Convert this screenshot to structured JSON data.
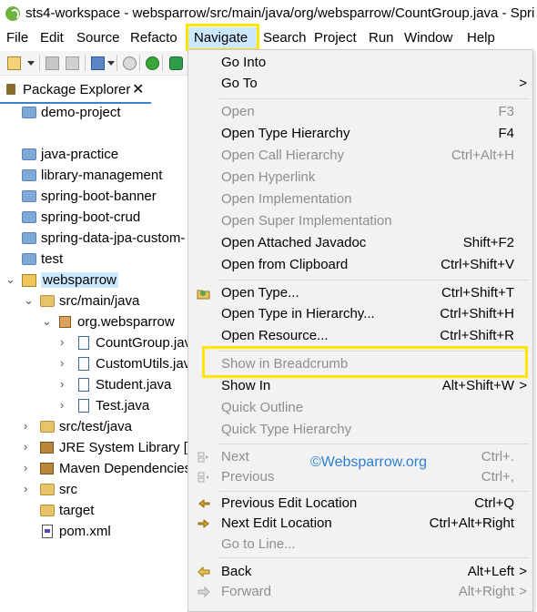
{
  "window": {
    "title": "sts4-workspace - websparrow/src/main/java/org/websparrow/CountGroup.java - Spri"
  },
  "menubar": {
    "items": [
      "File",
      "Edit",
      "Source",
      "Refacto",
      "Navigate",
      "Search",
      "Project",
      "Run",
      "Window",
      "Help"
    ],
    "active": "Navigate"
  },
  "explorer": {
    "tab_label": "Package Explorer",
    "close_glyph": "✕",
    "items": [
      {
        "label": "demo-project"
      },
      {
        "label": "java-practice"
      },
      {
        "label": "library-management"
      },
      {
        "label": "spring-boot-banner"
      },
      {
        "label": "spring-boot-crud"
      },
      {
        "label": "spring-data-jpa-custom-"
      },
      {
        "label": "test"
      },
      {
        "label": "websparrow"
      },
      {
        "label": "src/main/java"
      },
      {
        "label": "org.websparrow"
      },
      {
        "label": "CountGroup.java"
      },
      {
        "label": "CustomUtils.java"
      },
      {
        "label": "Student.java"
      },
      {
        "label": "Test.java"
      },
      {
        "label": "src/test/java"
      },
      {
        "label": "JRE System Library [Ja"
      },
      {
        "label": "Maven Dependencies"
      },
      {
        "label": "src"
      },
      {
        "label": "target"
      },
      {
        "label": "pom.xml"
      }
    ]
  },
  "navigate_menu": {
    "items": [
      {
        "label": "Go Into",
        "shortcut": "",
        "submenu": "",
        "enabled": true,
        "icon": ""
      },
      {
        "label": "Go To",
        "shortcut": "",
        "submenu": ">",
        "enabled": true,
        "icon": ""
      },
      {
        "label": "Open",
        "shortcut": "F3",
        "submenu": "",
        "enabled": false,
        "icon": ""
      },
      {
        "label": "Open Type Hierarchy",
        "shortcut": "F4",
        "submenu": "",
        "enabled": true,
        "icon": ""
      },
      {
        "label": "Open Call Hierarchy",
        "shortcut": "Ctrl+Alt+H",
        "submenu": "",
        "enabled": false,
        "icon": ""
      },
      {
        "label": "Open Hyperlink",
        "shortcut": "",
        "submenu": "",
        "enabled": false,
        "icon": ""
      },
      {
        "label": "Open Implementation",
        "shortcut": "",
        "submenu": "",
        "enabled": false,
        "icon": ""
      },
      {
        "label": "Open Super Implementation",
        "shortcut": "",
        "submenu": "",
        "enabled": false,
        "icon": ""
      },
      {
        "label": "Open Attached Javadoc",
        "shortcut": "Shift+F2",
        "submenu": "",
        "enabled": true,
        "icon": ""
      },
      {
        "label": "Open from Clipboard",
        "shortcut": "Ctrl+Shift+V",
        "submenu": "",
        "enabled": true,
        "icon": ""
      },
      {
        "label": "Open Type...",
        "shortcut": "Ctrl+Shift+T",
        "submenu": "",
        "enabled": true,
        "icon": "open-type-icon"
      },
      {
        "label": "Open Type in Hierarchy...",
        "shortcut": "Ctrl+Shift+H",
        "submenu": "",
        "enabled": true,
        "icon": ""
      },
      {
        "label": "Open Resource...",
        "shortcut": "Ctrl+Shift+R",
        "submenu": "",
        "enabled": true,
        "icon": ""
      },
      {
        "label": "Show in Breadcrumb",
        "shortcut": "",
        "submenu": "",
        "enabled": false,
        "icon": ""
      },
      {
        "label": "Show In",
        "shortcut": "Alt+Shift+W",
        "submenu": ">",
        "enabled": true,
        "icon": ""
      },
      {
        "label": "Quick Outline",
        "shortcut": "",
        "submenu": "",
        "enabled": false,
        "icon": ""
      },
      {
        "label": "Quick Type Hierarchy",
        "shortcut": "",
        "submenu": "",
        "enabled": false,
        "icon": ""
      },
      {
        "label": "Next",
        "shortcut": "Ctrl+.",
        "submenu": "",
        "enabled": false,
        "icon": "next-annotation-icon"
      },
      {
        "label": "Previous",
        "shortcut": "Ctrl+,",
        "submenu": "",
        "enabled": false,
        "icon": "previous-annotation-icon"
      },
      {
        "label": "Previous Edit Location",
        "shortcut": "Ctrl+Q",
        "submenu": "",
        "enabled": true,
        "icon": "previous-edit-icon"
      },
      {
        "label": "Next Edit Location",
        "shortcut": "Ctrl+Alt+Right",
        "submenu": "",
        "enabled": true,
        "icon": "next-edit-icon"
      },
      {
        "label": "Go to Line...",
        "shortcut": "",
        "submenu": "",
        "enabled": false,
        "icon": ""
      },
      {
        "label": "Back",
        "shortcut": "Alt+Left",
        "submenu": ">",
        "enabled": true,
        "icon": "back-arrow-icon"
      },
      {
        "label": "Forward",
        "shortcut": "Alt+Right",
        "submenu": ">",
        "enabled": false,
        "icon": "forward-arrow-icon"
      }
    ],
    "watermark": "©Websparrow.org"
  },
  "colors": {
    "highlight_box": "#ffe600",
    "menu_bg": "#f2f2f2",
    "disabled_text": "#8e8e8e",
    "watermark": "#2f7fd0",
    "menubar_active_bg": "#cce8ff"
  }
}
